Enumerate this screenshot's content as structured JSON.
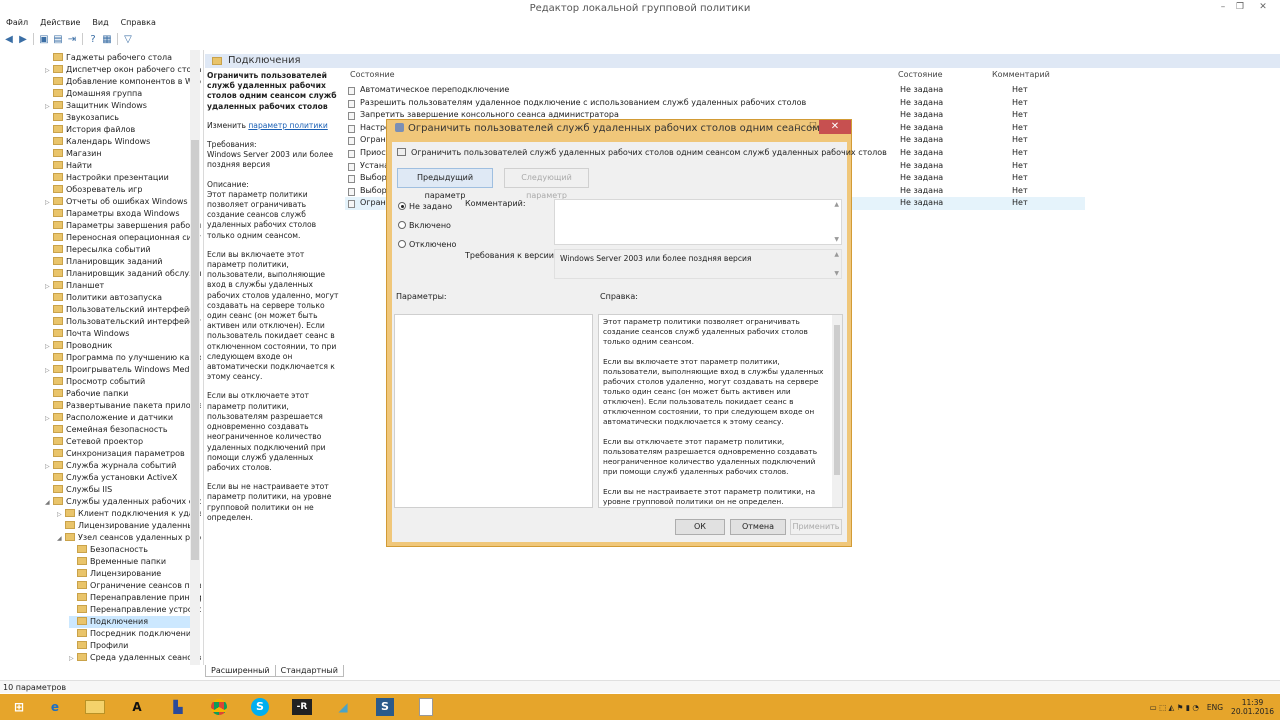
{
  "window": {
    "title": "Редактор локальной групповой политики",
    "min": "–",
    "max": "❐",
    "close": "✕"
  },
  "menu": [
    "Файл",
    "Действие",
    "Вид",
    "Справка"
  ],
  "tree": [
    {
      "label": "Гаджеты рабочего стола",
      "indent": 0,
      "arrow": ""
    },
    {
      "label": "Диспетчер окон рабочего стола",
      "indent": 0,
      "arrow": "▷"
    },
    {
      "label": "Добавление компонентов в Windows",
      "indent": 0,
      "arrow": ""
    },
    {
      "label": "Домашняя группа",
      "indent": 0,
      "arrow": ""
    },
    {
      "label": "Защитник Windows",
      "indent": 0,
      "arrow": "▷"
    },
    {
      "label": "Звукозапись",
      "indent": 0,
      "arrow": ""
    },
    {
      "label": "История файлов",
      "indent": 0,
      "arrow": ""
    },
    {
      "label": "Календарь Windows",
      "indent": 0,
      "arrow": ""
    },
    {
      "label": "Магазин",
      "indent": 0,
      "arrow": ""
    },
    {
      "label": "Найти",
      "indent": 0,
      "arrow": ""
    },
    {
      "label": "Настройки презентации",
      "indent": 0,
      "arrow": ""
    },
    {
      "label": "Обозреватель игр",
      "indent": 0,
      "arrow": ""
    },
    {
      "label": "Отчеты об ошибках Windows",
      "indent": 0,
      "arrow": "▷"
    },
    {
      "label": "Параметры входа Windows",
      "indent": 0,
      "arrow": ""
    },
    {
      "label": "Параметры завершения работы",
      "indent": 0,
      "arrow": ""
    },
    {
      "label": "Переносная операционная система",
      "indent": 0,
      "arrow": ""
    },
    {
      "label": "Пересылка событий",
      "indent": 0,
      "arrow": ""
    },
    {
      "label": "Планировщик заданий",
      "indent": 0,
      "arrow": ""
    },
    {
      "label": "Планировщик заданий обслуживания",
      "indent": 0,
      "arrow": ""
    },
    {
      "label": "Планшет",
      "indent": 0,
      "arrow": "▷"
    },
    {
      "label": "Политики автозапуска",
      "indent": 0,
      "arrow": ""
    },
    {
      "label": "Пользовательский интерфейс границ",
      "indent": 0,
      "arrow": ""
    },
    {
      "label": "Пользовательский интерфейс учетных",
      "indent": 0,
      "arrow": ""
    },
    {
      "label": "Почта Windows",
      "indent": 0,
      "arrow": ""
    },
    {
      "label": "Проводник",
      "indent": 0,
      "arrow": "▷"
    },
    {
      "label": "Программа по улучшению качества",
      "indent": 0,
      "arrow": ""
    },
    {
      "label": "Проигрыватель Windows Media",
      "indent": 0,
      "arrow": "▷"
    },
    {
      "label": "Просмотр событий",
      "indent": 0,
      "arrow": ""
    },
    {
      "label": "Рабочие папки",
      "indent": 0,
      "arrow": ""
    },
    {
      "label": "Развертывание пакета приложений",
      "indent": 0,
      "arrow": ""
    },
    {
      "label": "Расположение и датчики",
      "indent": 0,
      "arrow": "▷"
    },
    {
      "label": "Семейная безопасность",
      "indent": 0,
      "arrow": ""
    },
    {
      "label": "Сетевой проектор",
      "indent": 0,
      "arrow": ""
    },
    {
      "label": "Синхронизация параметров",
      "indent": 0,
      "arrow": ""
    },
    {
      "label": "Служба журнала событий",
      "indent": 0,
      "arrow": "▷"
    },
    {
      "label": "Служба установки ActiveX",
      "indent": 0,
      "arrow": ""
    },
    {
      "label": "Службы IIS",
      "indent": 0,
      "arrow": ""
    },
    {
      "label": "Службы удаленных рабочих столов",
      "indent": 0,
      "arrow": "◢"
    },
    {
      "label": "Клиент подключения к удаленному",
      "indent": 1,
      "arrow": "▷"
    },
    {
      "label": "Лицензирование удаленных рабочих",
      "indent": 1,
      "arrow": ""
    },
    {
      "label": "Узел сеансов удаленных рабочих",
      "indent": 1,
      "arrow": "◢"
    },
    {
      "label": "Безопасность",
      "indent": 2,
      "arrow": ""
    },
    {
      "label": "Временные папки",
      "indent": 2,
      "arrow": ""
    },
    {
      "label": "Лицензирование",
      "indent": 2,
      "arrow": ""
    },
    {
      "label": "Ограничение сеансов по времени",
      "indent": 2,
      "arrow": ""
    },
    {
      "label": "Перенаправление принтеров",
      "indent": 2,
      "arrow": ""
    },
    {
      "label": "Перенаправление устройств",
      "indent": 2,
      "arrow": ""
    },
    {
      "label": "Подключения",
      "indent": 2,
      "arrow": "",
      "selected": true
    },
    {
      "label": "Посредник подключений",
      "indent": 2,
      "arrow": ""
    },
    {
      "label": "Профили",
      "indent": 2,
      "arrow": ""
    },
    {
      "label": "Среда удаленных сеансов",
      "indent": 2,
      "arrow": "▷"
    }
  ],
  "header": {
    "title": "Подключения"
  },
  "description": {
    "title": "Ограничить пользователей служб удаленных рабочих столов одним сеансом служб удаленных рабочих столов",
    "edit_prefix": "Изменить ",
    "edit_link": "параметр политики",
    "req_label": "Требования:",
    "req_text": "Windows Server 2003 или более поздняя версия",
    "desc_label": "Описание:",
    "p1": "Этот параметр политики позволяет ограничивать создание сеансов служб удаленных рабочих столов только одним сеансом.",
    "p2": "Если вы включаете этот параметр политики, пользователи, выполняющие вход в службы удаленных рабочих столов удаленно, могут создавать на сервере только один сеанс (он может быть активен или отключен). Если пользователь покидает сеанс в отключенном состоянии, то при следующем входе он автоматически подключается к этому сеансу.",
    "p3": "Если вы отключаете этот параметр политики, пользователям разрешается одновременно создавать неограниченное количество удаленных подключений при помощи служб удаленных рабочих столов.",
    "p4": "Если вы не настраиваете этот параметр политики, на уровне групповой политики он не определен."
  },
  "list": {
    "col_name": "Состояние",
    "col_state": "Состояние",
    "col_comment": "Комментарий",
    "rows": [
      {
        "name": "Автоматическое переподключение",
        "state": "Не задана",
        "comment": "Нет"
      },
      {
        "name": "Разрешить пользователям удаленное подключение с использованием служб удаленных рабочих столов",
        "state": "Не задана",
        "comment": "Нет"
      },
      {
        "name": "Запретить завершение консольного сеанса администратора",
        "state": "Не задана",
        "comment": "Нет"
      },
      {
        "name": "Настро",
        "state": "Не задана",
        "comment": "Нет"
      },
      {
        "name": "Ограни",
        "state": "Не задана",
        "comment": "Нет"
      },
      {
        "name": "Приост",
        "state": "Не задана",
        "comment": "Нет"
      },
      {
        "name": "Устана",
        "state": "Не задана",
        "comment": "Нет"
      },
      {
        "name": "Выбор",
        "state": "Не задана",
        "comment": "Нет"
      },
      {
        "name": "Выбор",
        "state": "Не задана",
        "comment": "Нет"
      },
      {
        "name": "Ограни",
        "state": "Не задана",
        "comment": "Нет"
      }
    ]
  },
  "tabs": [
    "Расширенный",
    "Стандартный"
  ],
  "status": "10 параметров",
  "dialog": {
    "title": "Ограничить пользователей служб удаленных рабочих столов одним сеансом ...",
    "subtitle": "Ограничить пользователей служб удаленных рабочих столов одним сеансом служб удаленных рабочих столов",
    "prev": "Предыдущий параметр",
    "next": "Следующий параметр",
    "radio_not_set": "Не задано",
    "radio_enabled": "Включено",
    "radio_disabled": "Отключено",
    "comment_label": "Комментарий:",
    "req_label": "Требования к версии:",
    "req_value": "Windows Server 2003 или более поздняя версия",
    "params_label": "Параметры:",
    "help_label": "Справка:",
    "help_p1": "Этот параметр политики позволяет ограничивать создание сеансов служб удаленных рабочих столов только одним сеансом.",
    "help_p2": "Если вы включаете этот параметр политики, пользователи, выполняющие вход в службы удаленных рабочих столов удаленно, могут создавать на сервере только один сеанс (он может быть активен или отключен). Если пользователь покидает сеанс в отключенном состоянии, то при следующем входе он автоматически подключается к этому сеансу.",
    "help_p3": "Если вы отключаете этот параметр политики, пользователям разрешается одновременно создавать неограниченное количество удаленных подключений при помощи служб удаленных рабочих столов.",
    "help_p4": "Если вы не настраиваете этот параметр политики, на уровне групповой политики он не определен.",
    "ok": "ОК",
    "cancel": "Отмена",
    "apply": "Применить"
  },
  "taskbar": {
    "icons": [
      "windows-start-icon",
      "internet-explorer-icon",
      "file-explorer-icon",
      "font-a-icon",
      "security-icon",
      "chrome-icon",
      "skype-icon",
      "r-app-icon",
      "pen-icon",
      "snagit-icon",
      "notepad-icon"
    ],
    "lang": "ENG",
    "time": "11:39",
    "date": "20.01.2016"
  },
  "colors": {
    "dialog_frame": "#f0c77a",
    "taskbar": "#e6a52b",
    "close": "#c75050"
  }
}
